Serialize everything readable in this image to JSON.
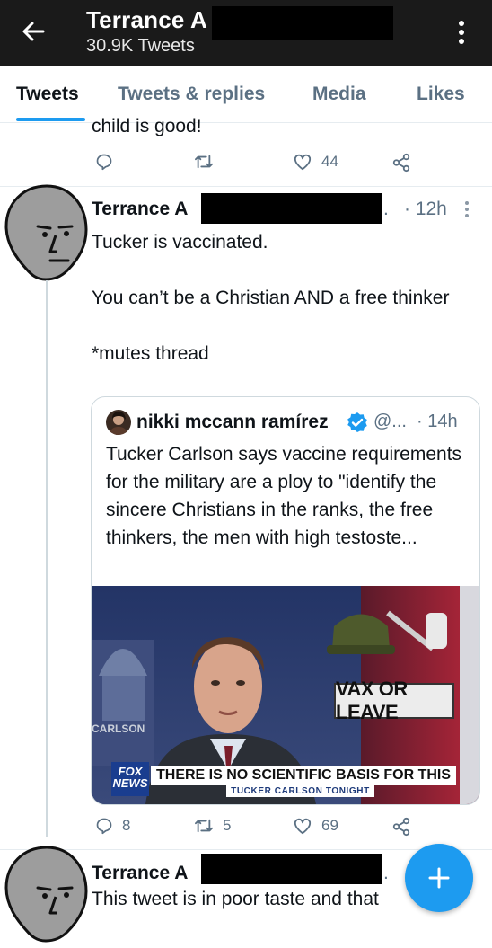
{
  "header": {
    "name": "Terrance A",
    "tweet_count": "30.9K Tweets"
  },
  "tabs": [
    {
      "label": "Tweets",
      "active": true
    },
    {
      "label": "Tweets & replies",
      "active": false
    },
    {
      "label": "Media",
      "active": false
    },
    {
      "label": "Likes",
      "active": false
    }
  ],
  "prev_tweet": {
    "text_fragment": "child is good!",
    "likes": "44"
  },
  "tweet": {
    "author": "Terrance A",
    "dot": ".",
    "time": "· 12h",
    "paragraphs": [
      "Tucker is vaccinated.",
      "You can’t be a Christian AND a free thinker",
      "*mutes thread"
    ],
    "replies": "8",
    "retweets": "5",
    "likes": "69"
  },
  "quote": {
    "name": "nikki mccann ramírez",
    "handle": "@...",
    "time": "· 14h",
    "text": "Tucker Carlson says vaccine requirements for the military are a ploy to \"identify the sincere Christians in the ranks, the free thinkers, the men with high testoste...",
    "media": {
      "banner": "VAX OR LEAVE",
      "chyron": "THERE IS NO SCIENTIFIC BASIS FOR THIS",
      "chyron_sub": "TUCKER CARLSON TONIGHT",
      "logo": "FOX NEWS",
      "wall_text": "CARLSON"
    }
  },
  "next_tweet": {
    "author": "Terrance A",
    "dot": ".",
    "text_fragment": "This tweet is in poor taste and that"
  },
  "colors": {
    "accent": "#1d9bf0",
    "top_bar": "#1a1a1a",
    "muted": "#5b7083"
  },
  "icons": [
    "back-arrow-icon",
    "more-vertical-icon",
    "reply-icon",
    "retweet-icon",
    "like-icon",
    "share-icon",
    "verified-icon",
    "compose-plus-icon",
    "npc-avatar"
  ]
}
